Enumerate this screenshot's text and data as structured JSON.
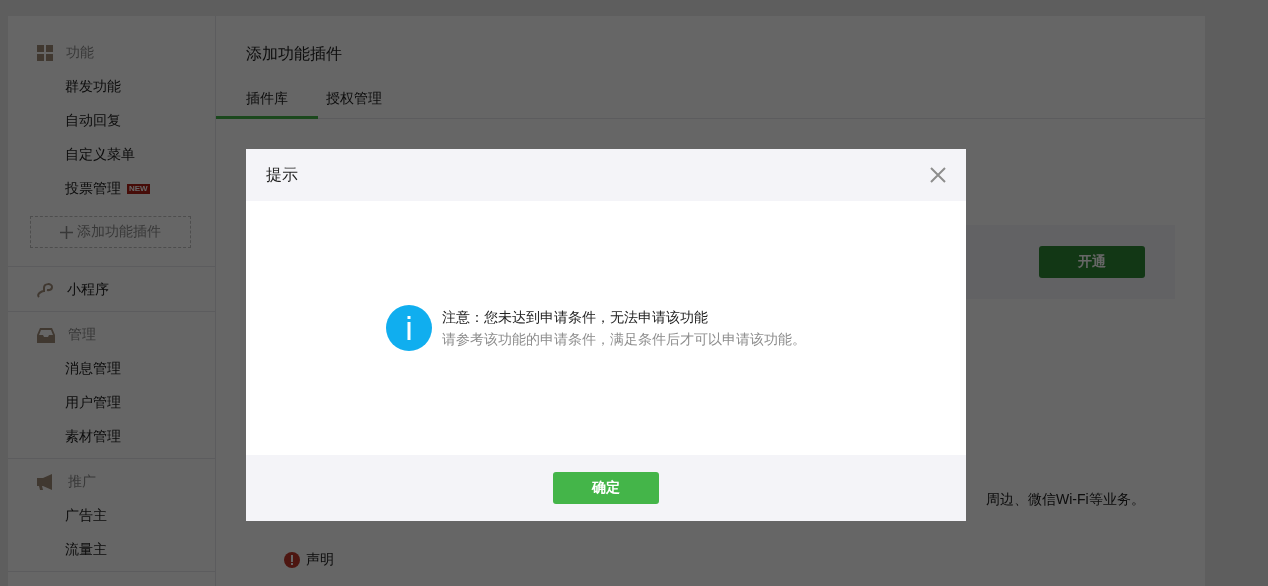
{
  "sidebar": {
    "groups": [
      {
        "title": "功能",
        "items": [
          {
            "label": "群发功能"
          },
          {
            "label": "自动回复"
          },
          {
            "label": "自定义菜单"
          },
          {
            "label": "投票管理",
            "badge": "NEW"
          }
        ],
        "add_button": "添加功能插件"
      },
      {
        "title": "小程序"
      },
      {
        "title": "管理",
        "items": [
          {
            "label": "消息管理"
          },
          {
            "label": "用户管理"
          },
          {
            "label": "素材管理"
          }
        ]
      },
      {
        "title": "推广",
        "items": [
          {
            "label": "广告主"
          },
          {
            "label": "流量主"
          }
        ]
      }
    ]
  },
  "page": {
    "title": "添加功能插件",
    "tabs": [
      {
        "label": "插件库",
        "selected": true
      },
      {
        "label": "授权管理",
        "selected": false
      }
    ],
    "plugin_card": {
      "button": "开通"
    },
    "description_tail": "周边、微信Wi-Fi等业务。",
    "notice": {
      "title": "声明"
    }
  },
  "dialog": {
    "title": "提示",
    "message": "注意：您未达到申请条件，无法申请该功能",
    "detail": "请参考该功能的申请条件，满足条件后才可以申请该功能。",
    "confirm_button": "确定"
  }
}
